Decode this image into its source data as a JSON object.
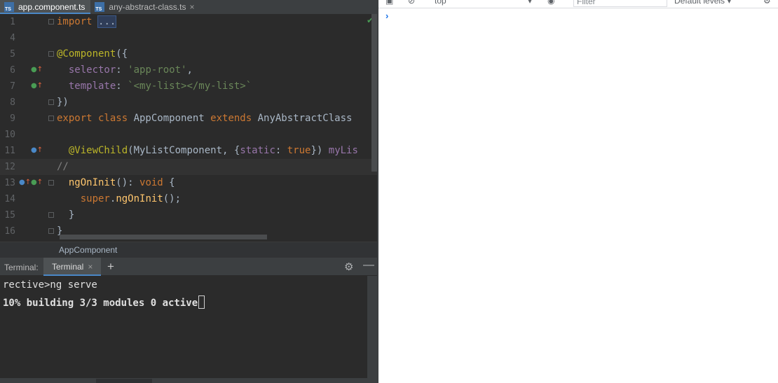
{
  "tabs": [
    {
      "label": "app.component.ts",
      "active": true,
      "icon": "TS"
    },
    {
      "label": "any-abstract-class.ts",
      "active": false,
      "icon": "TS"
    }
  ],
  "editor": {
    "lines": [
      {
        "n": "1",
        "fold": true,
        "icons": "",
        "tokens": [
          [
            "kw",
            "import"
          ],
          [
            "p",
            " "
          ],
          [
            "collapsed",
            "..."
          ]
        ]
      },
      {
        "n": "4",
        "fold": false,
        "icons": "",
        "tokens": []
      },
      {
        "n": "5",
        "fold": true,
        "icons": "",
        "tokens": [
          [
            "ann",
            "@Component"
          ],
          [
            "p",
            "({"
          ]
        ]
      },
      {
        "n": "6",
        "fold": false,
        "icons": "impl",
        "tokens": [
          [
            "fld",
            "  selector"
          ],
          [
            "p",
            ": "
          ],
          [
            "str",
            "'app-root'"
          ],
          [
            "p",
            ","
          ]
        ]
      },
      {
        "n": "7",
        "fold": false,
        "icons": "impl",
        "tokens": [
          [
            "fld",
            "  template"
          ],
          [
            "p",
            ": "
          ],
          [
            "str",
            "`<my-list></my-list>`"
          ]
        ]
      },
      {
        "n": "8",
        "fold": true,
        "icons": "",
        "tokens": [
          [
            "p",
            "})"
          ]
        ]
      },
      {
        "n": "9",
        "fold": true,
        "icons": "",
        "tokens": [
          [
            "kw",
            "export class "
          ],
          [
            "p",
            "AppComponent "
          ],
          [
            "kw",
            "extends "
          ],
          [
            "p",
            "AnyAbstractClass"
          ]
        ]
      },
      {
        "n": "10",
        "fold": false,
        "icons": "",
        "tokens": []
      },
      {
        "n": "11",
        "fold": false,
        "icons": "override",
        "tokens": [
          [
            "p",
            "  "
          ],
          [
            "ann",
            "@ViewChild"
          ],
          [
            "p",
            "(MyListComponent, {"
          ],
          [
            "fld",
            "static"
          ],
          [
            "p",
            ": "
          ],
          [
            "kw",
            "true"
          ],
          [
            "p",
            "}) "
          ],
          [
            "fld",
            "myLis"
          ]
        ]
      },
      {
        "n": "12",
        "fold": false,
        "icons": "",
        "current": true,
        "tokens": [
          [
            "cmt",
            "//"
          ]
        ]
      },
      {
        "n": "13",
        "fold": true,
        "icons": "both",
        "tokens": [
          [
            "p",
            "  "
          ],
          [
            "fn",
            "ngOnInit"
          ],
          [
            "p",
            "(): "
          ],
          [
            "kw",
            "void "
          ],
          [
            "p",
            "{"
          ]
        ]
      },
      {
        "n": "14",
        "fold": false,
        "icons": "",
        "tokens": [
          [
            "p",
            "    "
          ],
          [
            "kw",
            "super"
          ],
          [
            "p",
            "."
          ],
          [
            "fn",
            "ngOnInit"
          ],
          [
            "p",
            "();"
          ]
        ]
      },
      {
        "n": "15",
        "fold": true,
        "icons": "",
        "tokens": [
          [
            "p",
            "  }"
          ]
        ]
      },
      {
        "n": "16",
        "fold": true,
        "icons": "",
        "tokens": [
          [
            "p",
            "}"
          ]
        ]
      }
    ]
  },
  "breadcrumb": "AppComponent",
  "terminal": {
    "title": "Terminal:",
    "tab_label": "Terminal",
    "close_glyph": "×",
    "add_glyph": "+",
    "gear_glyph": "⚙",
    "minimize_glyph": "—",
    "line1": "rective>ng serve",
    "line2": "10% building 3/3 modules 0 active"
  },
  "devtools": {
    "context": "top",
    "filter_placeholder": "Filter",
    "levels": "Default levels ▾",
    "prompt": "›"
  },
  "colors": {
    "keyword": "#cc7832",
    "annotation": "#bbb529",
    "string": "#6a8759",
    "field": "#9876aa",
    "function": "#ffc66d",
    "text": "#a9b7c6",
    "accent": "#4a88c7"
  }
}
